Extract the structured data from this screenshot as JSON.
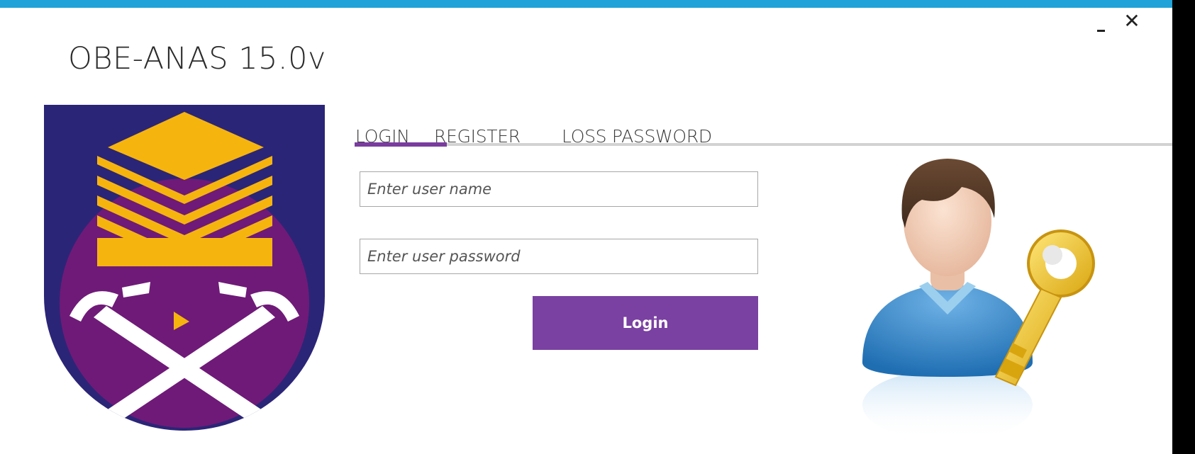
{
  "window": {
    "title": "OBE-ANAS 15.0v",
    "minimize_icon": "minimize-icon",
    "close_symbol": "✕",
    "accent_color": "#1fa3d8"
  },
  "tabs": [
    {
      "label": "LOGIN",
      "active": true
    },
    {
      "label": "REGISTER",
      "active": false
    },
    {
      "label": "LOSS PASSWORD",
      "active": false
    }
  ],
  "tab_accent_color": "#7a3c9e",
  "form": {
    "username_placeholder": "Enter user name",
    "username_value": "",
    "password_placeholder": "Enter user password",
    "password_value": "",
    "login_label": "Login",
    "button_color": "#7a40a2"
  },
  "images": {
    "logo": "university-crest-logo",
    "illustration": "user-with-key-illustration"
  }
}
